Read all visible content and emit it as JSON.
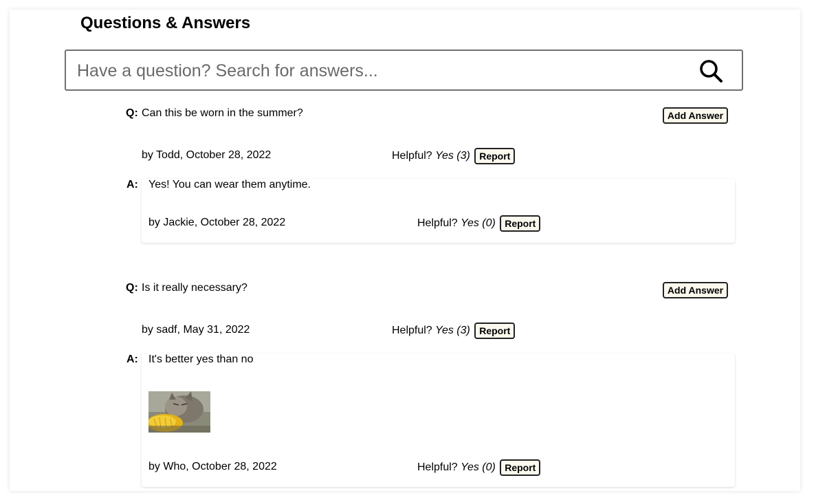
{
  "header": {
    "title": "Questions & Answers"
  },
  "search": {
    "placeholder": "Have a question? Search for answers...",
    "value": ""
  },
  "labels": {
    "q_prefix": "Q:",
    "a_prefix": "A:",
    "helpful": "Helpful?",
    "add_answer": "Add Answer",
    "report": "Report"
  },
  "questions": [
    {
      "body": "Can this be worn in the summer?",
      "meta": "by Todd, October 28, 2022",
      "helpful_yes": "Yes (3)",
      "answers": [
        {
          "body": "Yes! You can wear them anytime.",
          "meta": "by Jackie, October 28, 2022",
          "helpful_yes": "Yes (0)",
          "has_photo": false
        }
      ]
    },
    {
      "body": "Is it really necessary?",
      "meta": "by sadf, May 31, 2022",
      "helpful_yes": "Yes (3)",
      "answers": [
        {
          "body": "It's better yes than no",
          "meta": "by Who, October 28, 2022",
          "helpful_yes": "Yes (0)",
          "has_photo": true,
          "photo_icon": "cat-eating-corn-photo"
        }
      ]
    }
  ],
  "colors": {
    "button_bg": "#fbf8ee",
    "border": "#707070",
    "placeholder": "#6a6a6a"
  }
}
